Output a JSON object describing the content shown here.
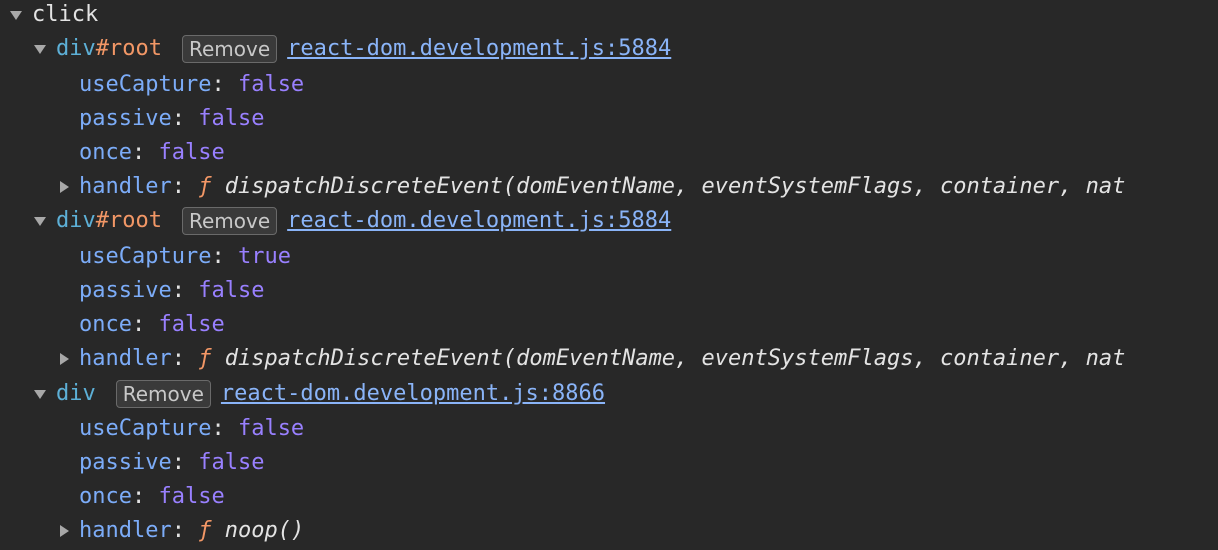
{
  "event": {
    "name": "click"
  },
  "listeners": [
    {
      "node_tag": "div",
      "node_id": "#root",
      "remove_label": "Remove",
      "source_link": "react-dom.development.js:5884",
      "useCapture": {
        "key": "useCapture",
        "value": "false"
      },
      "passive": {
        "key": "passive",
        "value": "false"
      },
      "once": {
        "key": "once",
        "value": "false"
      },
      "handler": {
        "key": "handler",
        "symbol": "ƒ",
        "signature": "dispatchDiscreteEvent(domEventName, eventSystemFlags, container, nat"
      }
    },
    {
      "node_tag": "div",
      "node_id": "#root",
      "remove_label": "Remove",
      "source_link": "react-dom.development.js:5884",
      "useCapture": {
        "key": "useCapture",
        "value": "true"
      },
      "passive": {
        "key": "passive",
        "value": "false"
      },
      "once": {
        "key": "once",
        "value": "false"
      },
      "handler": {
        "key": "handler",
        "symbol": "ƒ",
        "signature": "dispatchDiscreteEvent(domEventName, eventSystemFlags, container, nat"
      }
    },
    {
      "node_tag": "div",
      "node_id": "",
      "remove_label": "Remove",
      "source_link": "react-dom.development.js:8866",
      "useCapture": {
        "key": "useCapture",
        "value": "false"
      },
      "passive": {
        "key": "passive",
        "value": "false"
      },
      "once": {
        "key": "once",
        "value": "false"
      },
      "handler": {
        "key": "handler",
        "symbol": "ƒ",
        "signature": "noop()"
      }
    }
  ],
  "colors": {
    "background": "#282828",
    "tag": "#5db0d7",
    "tag_id": "#f29766",
    "property": "#7cacf8",
    "keyword": "#9980ff",
    "link": "#8ab4f8"
  },
  "icons": {
    "expanded": "triangle-down-icon",
    "collapsed": "triangle-right-icon"
  }
}
